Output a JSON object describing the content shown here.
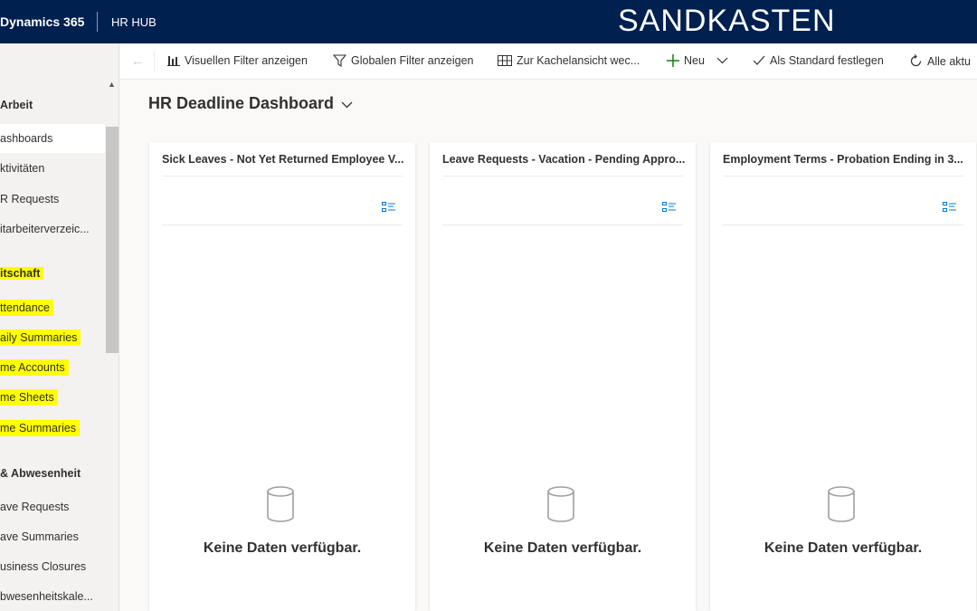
{
  "topbar": {
    "brand": "Dynamics 365",
    "app": "HR HUB",
    "environment": "SANDKASTEN"
  },
  "sidebar": {
    "section_work": "Arbeit",
    "items_work": [
      "ashboards",
      "ktivitäten",
      "R Requests",
      "itarbeiterverzeic..."
    ],
    "section_2": "itschaft",
    "items_2": [
      "ttendance",
      "aily Summaries",
      "me Accounts",
      "me Sheets",
      "me Summaries"
    ],
    "section_absence": "& Abwesenheit",
    "items_absence": [
      "ave Requests",
      "ave Summaries",
      "usiness Closures",
      "bwesenheitskale..."
    ],
    "highlight_color": "#ffff00"
  },
  "commandbar": {
    "back_icon": "arrow-left-icon",
    "visual_filter": "Visuellen Filter anzeigen",
    "global_filter": "Globalen Filter anzeigen",
    "tile_view": "Zur Kachelansicht wec...",
    "new": "Neu",
    "set_default": "Als Standard festlegen",
    "refresh_all": "Alle aktu"
  },
  "dashboard": {
    "title": "HR Deadline Dashboard",
    "cards": [
      {
        "title": "Sick Leaves - Not Yet Returned Employee V...",
        "empty": "Keine Daten verfügbar."
      },
      {
        "title": "Leave Requests - Vacation - Pending Appro...",
        "empty": "Keine Daten verfügbar."
      },
      {
        "title": "Employment Terms - Probation Ending in 3...",
        "empty": "Keine Daten verfügbar."
      }
    ]
  },
  "colors": {
    "topbar": "#002050",
    "accent": "#0078d4",
    "green_plus": "#107c10"
  }
}
